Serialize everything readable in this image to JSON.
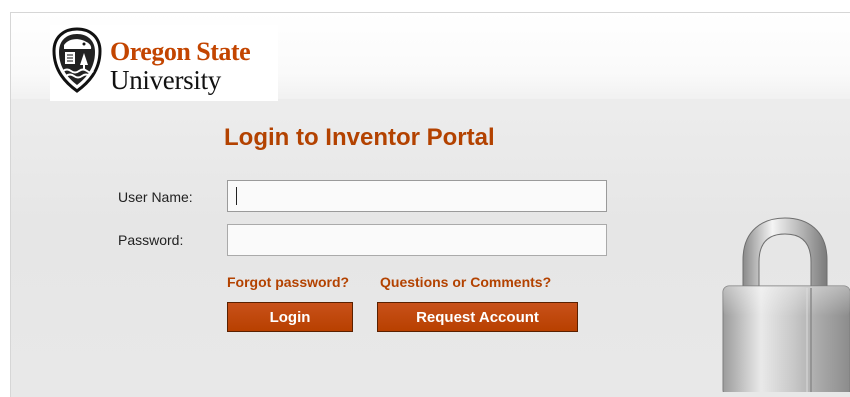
{
  "logo": {
    "line1": "Oregon State",
    "line2": "University"
  },
  "page": {
    "title": "Login to Inventor Portal"
  },
  "form": {
    "username_label": "User Name:",
    "username_value": "",
    "password_label": "Password:",
    "password_value": ""
  },
  "links": {
    "forgot_password": "Forgot password?",
    "questions": "Questions or Comments?"
  },
  "buttons": {
    "login": "Login",
    "request_account": "Request Account"
  },
  "colors": {
    "accent": "#b34200",
    "button_bg": "#c04a0a",
    "button_border": "#5a2000"
  },
  "icons": {
    "seal": "osu-seal-icon",
    "lock": "padlock-icon"
  }
}
